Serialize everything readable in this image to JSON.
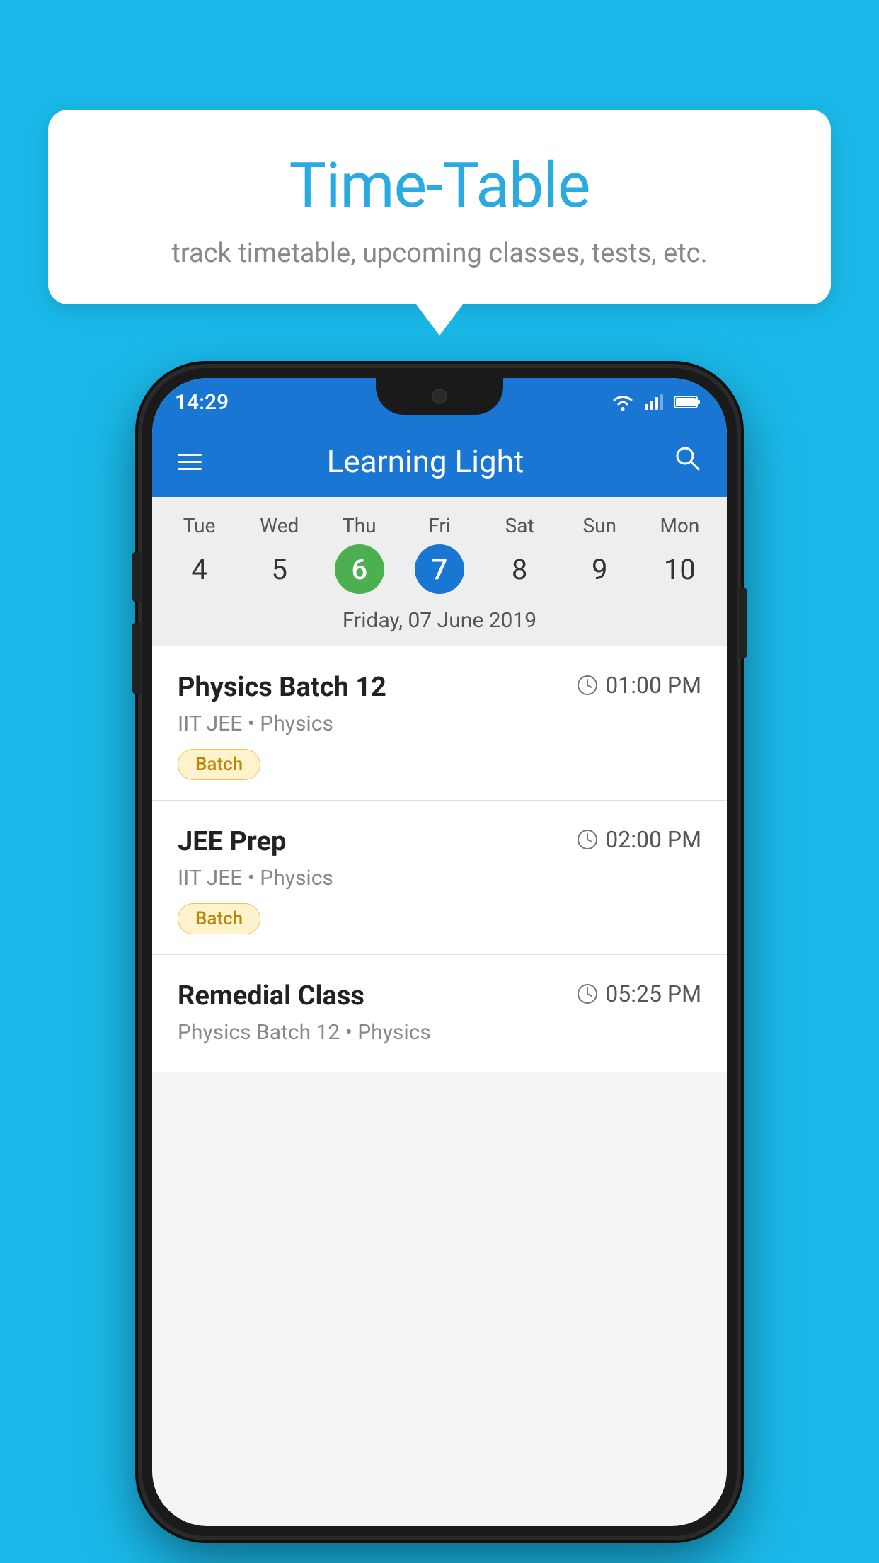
{
  "background_color": "#1ab8e8",
  "tooltip": {
    "title": "Time-Table",
    "subtitle": "track timetable, upcoming classes, tests, etc."
  },
  "phone": {
    "status_bar": {
      "time": "14:29"
    },
    "header": {
      "title": "Learning Light",
      "menu_icon": "menu-icon",
      "search_icon": "🔍"
    },
    "calendar": {
      "days": [
        {
          "name": "Tue",
          "number": "4",
          "state": "normal"
        },
        {
          "name": "Wed",
          "number": "5",
          "state": "normal"
        },
        {
          "name": "Thu",
          "number": "6",
          "state": "today"
        },
        {
          "name": "Fri",
          "number": "7",
          "state": "selected"
        },
        {
          "name": "Sat",
          "number": "8",
          "state": "normal"
        },
        {
          "name": "Sun",
          "number": "9",
          "state": "normal"
        },
        {
          "name": "Mon",
          "number": "10",
          "state": "normal"
        }
      ],
      "selected_date": "Friday, 07 June 2019"
    },
    "schedule": [
      {
        "title": "Physics Batch 12",
        "time": "01:00 PM",
        "subtitle": "IIT JEE • Physics",
        "badge": "Batch"
      },
      {
        "title": "JEE Prep",
        "time": "02:00 PM",
        "subtitle": "IIT JEE • Physics",
        "badge": "Batch"
      },
      {
        "title": "Remedial Class",
        "time": "05:25 PM",
        "subtitle": "Physics Batch 12 • Physics",
        "badge": null
      }
    ]
  }
}
